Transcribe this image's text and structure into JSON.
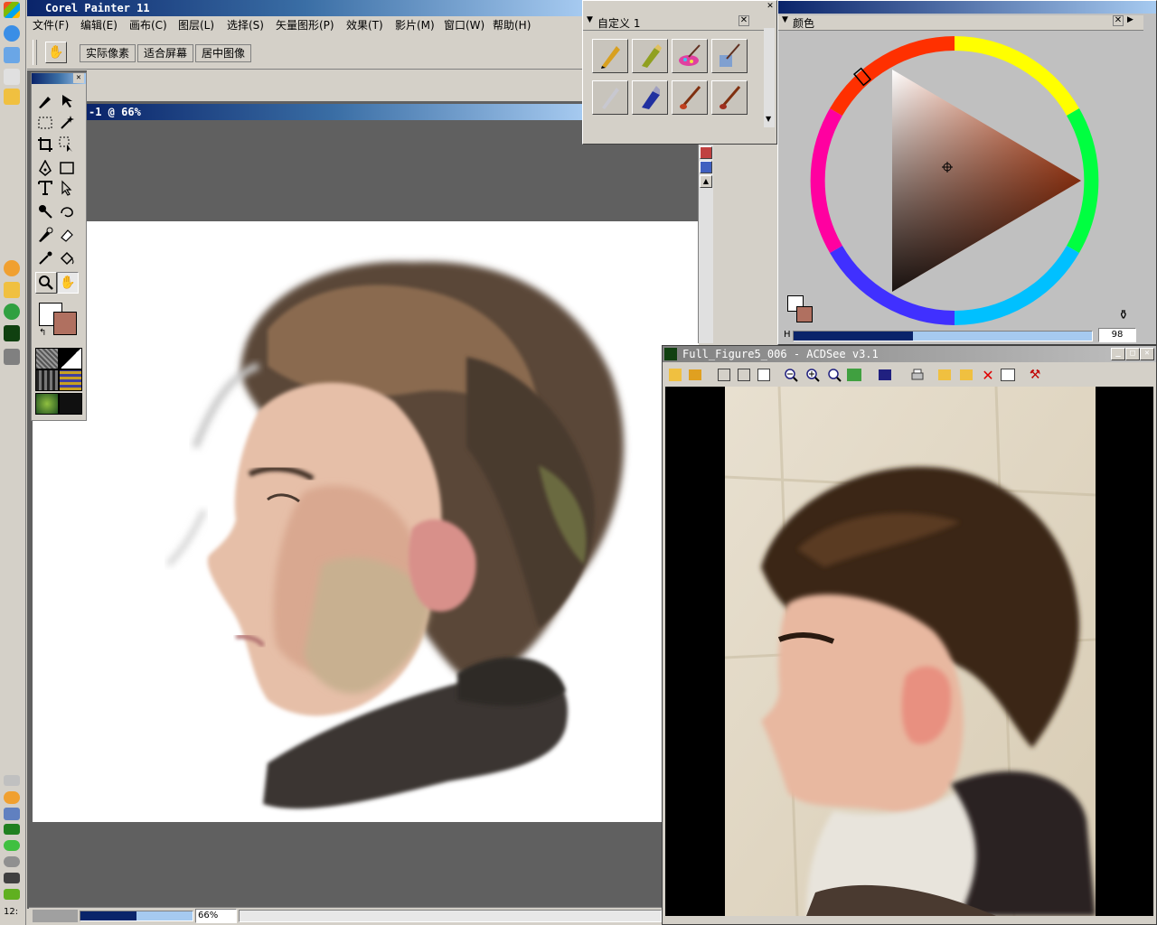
{
  "painter": {
    "title": "Corel Painter 11",
    "menu": [
      "文件(F)",
      "编辑(E)",
      "画布(C)",
      "图层(L)",
      "选择(S)",
      "矢量图形(P)",
      "效果(T)",
      "影片(M)",
      "窗口(W)",
      "帮助(H)"
    ],
    "toolbar": {
      "actual_pixels": "实际像素",
      "fit_screen": "适合屏幕",
      "center_image": "居中图像"
    },
    "document_title": "-1 @ 66%",
    "zoom": "66%",
    "clock": "12:"
  },
  "brush_palette": {
    "title": "自定义 1"
  },
  "color_palette": {
    "title": "颜色",
    "h_label": "H",
    "h_value": "98",
    "main_color": "#ffffff",
    "secondary_color": "#b07060"
  },
  "acdsee": {
    "title": "Full_Figure5_006 - ACDSee v3.1"
  },
  "icons": [
    "hand-icon",
    "brush-icon",
    "select-icon",
    "crop-icon",
    "pen-icon",
    "text-icon",
    "magnifier-icon",
    "eyedropper-icon",
    "eraser-icon",
    "bucket-icon",
    "zoom-in-icon",
    "zoom-out-icon",
    "print-icon",
    "delete-icon"
  ]
}
